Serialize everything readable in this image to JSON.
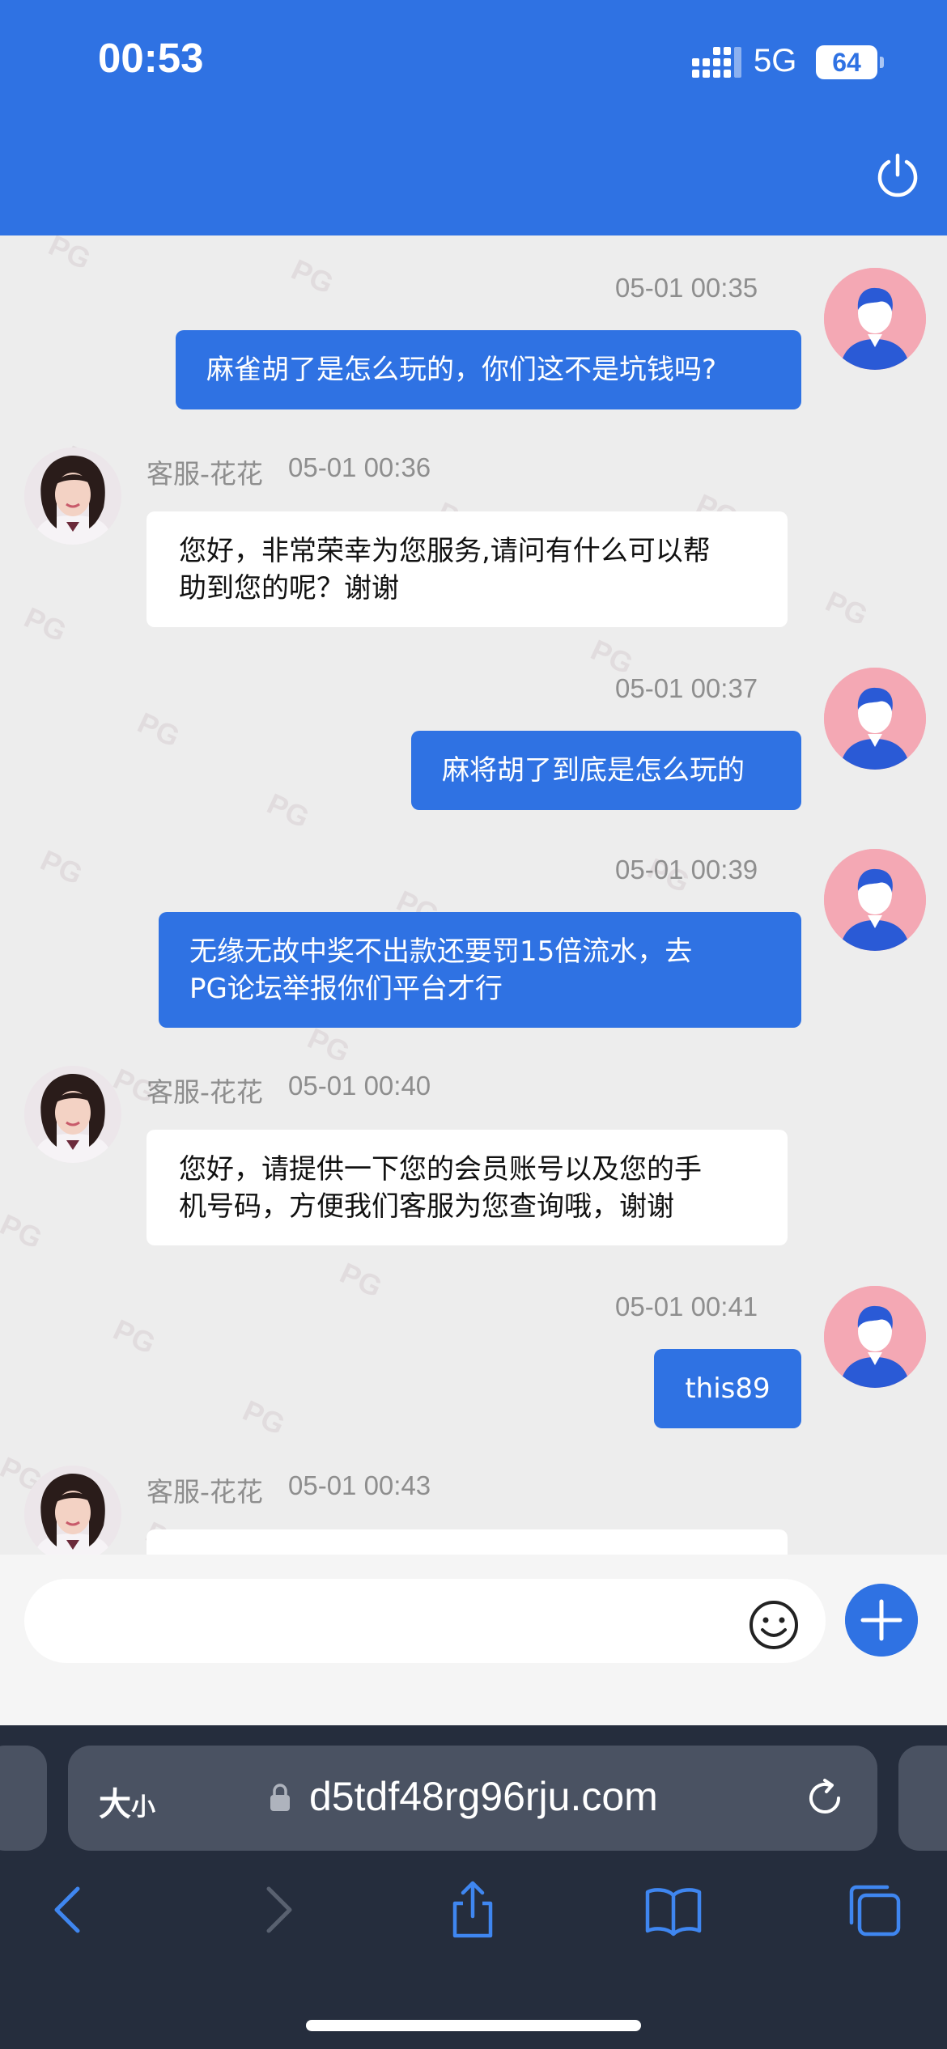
{
  "status_bar": {
    "time": "00:53",
    "network": "5G",
    "battery": "64"
  },
  "chat": {
    "messages": [
      {
        "side": "out",
        "time": "05-01 00:35",
        "text": "麻雀胡了是怎么玩的，你们这不是坑钱吗?"
      },
      {
        "side": "in",
        "sender": "客服-花花",
        "time": "05-01 00:36",
        "lines": [
          "您好，非常荣幸为您服务,请问有什么可以帮",
          "助到您的呢？谢谢"
        ]
      },
      {
        "side": "out",
        "time": "05-01 00:37",
        "text": "麻将胡了到底是怎么玩的"
      },
      {
        "side": "out",
        "time": "05-01 00:39",
        "lines": [
          "无缘无故中奖不出款还要罚15倍流水，去",
          "PG论坛举报你们平台才行"
        ]
      },
      {
        "side": "in",
        "sender": "客服-花花",
        "time": "05-01 00:40",
        "lines": [
          "您好，请提供一下您的会员账号以及您的手",
          "机号码，方便我们客服为您查询哦，谢谢"
        ]
      },
      {
        "side": "out",
        "time": "05-01 00:41",
        "text": "this89"
      },
      {
        "side": "in",
        "sender": "客服-花花",
        "time": "05-01 00:43"
      }
    ]
  },
  "input": {
    "placeholder": ""
  },
  "browser": {
    "text_size_big": "大",
    "text_size_small": "小",
    "url": "d5tdf48rg96rju.com"
  },
  "colors": {
    "header": "#2f72e3",
    "chat_bg": "#ededed",
    "outgoing_bubble": "#2f72e3",
    "browser_bar": "#252d3d"
  }
}
